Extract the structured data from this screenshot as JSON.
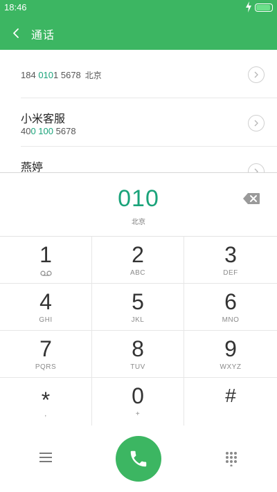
{
  "status": {
    "time": "18:46"
  },
  "header": {
    "title": "通话"
  },
  "contacts": [
    {
      "name": "",
      "number_pre": "184 ",
      "number_hl": "010",
      "number_post": "1 5678",
      "location": "北京"
    },
    {
      "name": "小米客服",
      "number_pre": "40",
      "number_hl": "0 100",
      "number_post": " 5678",
      "location": ""
    },
    {
      "name": "燕婷",
      "number_pre": "",
      "number_hl": "",
      "number_post": "",
      "location": ""
    }
  ],
  "input": {
    "dialed": "010",
    "location": "北京"
  },
  "keys": [
    {
      "digit": "1",
      "sub": ""
    },
    {
      "digit": "2",
      "sub": "ABC"
    },
    {
      "digit": "3",
      "sub": "DEF"
    },
    {
      "digit": "4",
      "sub": "GHI"
    },
    {
      "digit": "5",
      "sub": "JKL"
    },
    {
      "digit": "6",
      "sub": "MNO"
    },
    {
      "digit": "7",
      "sub": "PQRS"
    },
    {
      "digit": "8",
      "sub": "TUV"
    },
    {
      "digit": "9",
      "sub": "WXYZ"
    },
    {
      "digit": "*",
      "sub": ","
    },
    {
      "digit": "0",
      "sub": "+"
    },
    {
      "digit": "#",
      "sub": ""
    }
  ],
  "icons": {
    "back": "back-arrow-icon",
    "detail": "chevron-right-icon",
    "backspace": "backspace-icon",
    "voicemail": "voicemail-icon",
    "menu": "menu-icon",
    "call": "phone-icon",
    "dialpad": "dialpad-icon"
  },
  "colors": {
    "brand": "#3cb662",
    "highlight": "#1aa37a"
  }
}
